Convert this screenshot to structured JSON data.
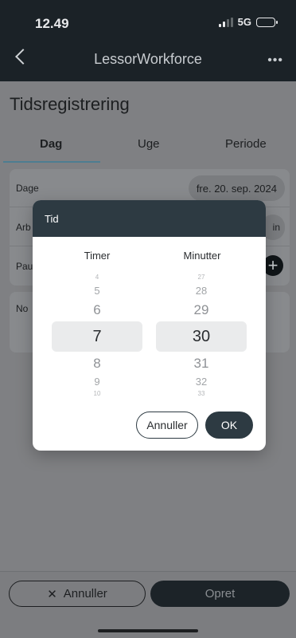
{
  "status_bar": {
    "time": "12.49",
    "network": "5G",
    "battery_level": 0.45
  },
  "nav": {
    "title": "LessorWorkforce",
    "more": "•••"
  },
  "page": {
    "title": "Tidsregistrering"
  },
  "tabs": [
    {
      "label": "Dag",
      "active": true
    },
    {
      "label": "Uge",
      "active": false
    },
    {
      "label": "Periode",
      "active": false
    }
  ],
  "form": {
    "dage_label": "Dage",
    "date_value": "fre. 20. sep. 2024",
    "arbejde_label_visible": "Arb",
    "arbejde_value_visible": "in",
    "pause_label_visible": "Pau",
    "note_label_visible": "No"
  },
  "dialog": {
    "title": "Tid",
    "hours_label": "Timer",
    "minutes_label": "Minutter",
    "hours_values": [
      "4",
      "5",
      "6",
      "7",
      "8",
      "9",
      "10"
    ],
    "minutes_values": [
      "27",
      "28",
      "29",
      "30",
      "31",
      "32",
      "33"
    ],
    "selected_hour": "7",
    "selected_minute": "30",
    "cancel_label": "Annuller",
    "ok_label": "OK"
  },
  "bottom": {
    "cancel_label": "Annuller",
    "cancel_icon": "✕",
    "create_label": "Opret"
  },
  "colors": {
    "header": "#1b2227",
    "dialog_header": "#2d3a42",
    "accent": "#4d7d91"
  }
}
